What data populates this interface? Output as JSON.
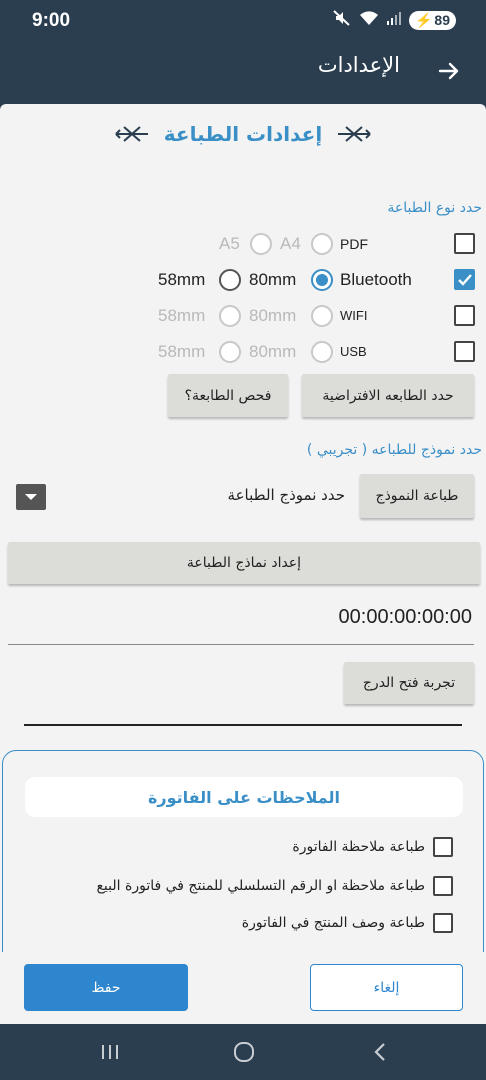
{
  "status_bar": {
    "time": "9:00",
    "battery": "89",
    "icons": [
      "mute-icon",
      "wifi-icon",
      "signal-icon",
      "battery-charging-icon"
    ]
  },
  "app_bar": {
    "title": "الإعدادات",
    "back_icon": "arrow-right-icon"
  },
  "printer_section": {
    "title": "إعدادات الطباعة",
    "type_label": "حدد نوع الطباعة",
    "rows": [
      {
        "type": "PDF",
        "checked": false,
        "enabled": false,
        "size_a": "A4",
        "size_b": "A5"
      },
      {
        "type": "Bluetooth",
        "checked": true,
        "enabled": true,
        "size_a": "80mm",
        "size_b": "58mm",
        "selected": "80mm"
      },
      {
        "type": "WIFI",
        "checked": false,
        "enabled": false,
        "size_a": "80mm",
        "size_b": "58mm"
      },
      {
        "type": "USB",
        "checked": false,
        "enabled": false,
        "size_a": "80mm",
        "size_b": "58mm"
      }
    ],
    "default_printer_button": "حدد الطابعه الافتراضية",
    "check_printer_button": "فحص الطابعة؟",
    "template_label": "حدد نموذج للطباعه ( تجريبي )",
    "print_template_button": "طباعة النموذج",
    "template_dropdown_value": "حدد نموذج الطباعة",
    "template_setup_button": "إعداد نماذج الطباعة",
    "mac_address": "00:00:00:00:00",
    "drawer_test_button": "تجربة فتح الدرج"
  },
  "notes_section": {
    "title": "الملاحظات على الفاتورة",
    "items": [
      {
        "label": "طباعة ملاحظة الفاتورة",
        "checked": false
      },
      {
        "label": "طباعة ملاحظة او الرقم التسلسلي للمنتج في فاتورة البيع",
        "checked": false
      },
      {
        "label": "طباعة وصف المنتج في الفاتورة",
        "checked": false
      }
    ]
  },
  "actions": {
    "save": "حفظ",
    "cancel": "إلغاء"
  },
  "nav": {
    "icons": [
      "recents-icon",
      "home-icon",
      "back-icon"
    ]
  },
  "colors": {
    "primary": "#2e86cf",
    "accent_text": "#3a8fc7",
    "header_bg": "#2b3e50",
    "surface": "#f3f3f3"
  }
}
